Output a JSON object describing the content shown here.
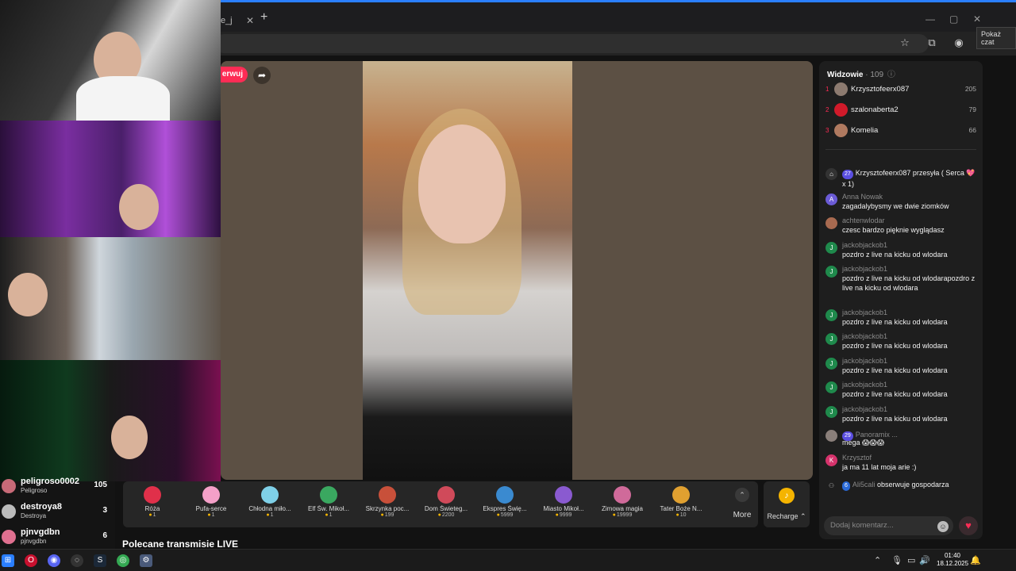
{
  "browser": {
    "tab_title": "we_j",
    "tab_close": "✕",
    "new_tab": "+",
    "tooltip": "Pokaż czat"
  },
  "stream": {
    "follow_label": "erwuj"
  },
  "viewers": {
    "title": "Widzowie",
    "count": "· 109",
    "top": [
      {
        "rank": "1",
        "name": "Krzysztofeerx087",
        "score": "205",
        "color": "#8d7b70"
      },
      {
        "rank": "2",
        "name": "szalonaberta2",
        "score": "79",
        "color": "#d11a2a"
      },
      {
        "rank": "3",
        "name": "Komelia",
        "score": "66",
        "color": "#b07a60"
      }
    ]
  },
  "chat": {
    "messages": [
      {
        "type": "gift",
        "badge": "27",
        "text": "Krzysztofeerx087 przesyła ( Serca 💖 x 1)"
      },
      {
        "user": "Anna Nowak",
        "text": "zagadalybysmy we dwie ziomków",
        "avatar": "A",
        "color": "#6b5bd6"
      },
      {
        "user": "achtenwlodar",
        "text": "czesc bardzo pięknie wyglądasz",
        "avatar": "",
        "color": "#a86a50"
      },
      {
        "user": "jackobjackob1",
        "text": "pozdro z live na kicku od wlodara",
        "avatar": "J",
        "color": "#1f8a4c"
      },
      {
        "user": "jackobjackob1",
        "text": "pozdro z live na kicku od wlodarapozdro z live na kicku od wlodara",
        "avatar": "J",
        "color": "#1f8a4c"
      },
      {
        "user": "jackobjackob1",
        "text": "pozdro z live na kicku od wlodara",
        "avatar": "J",
        "color": "#1f8a4c"
      },
      {
        "user": "jackobjackob1",
        "text": "pozdro z live na kicku od wlodara",
        "avatar": "J",
        "color": "#1f8a4c"
      },
      {
        "user": "jackobjackob1",
        "text": "pozdro z live na kicku od wlodara",
        "avatar": "J",
        "color": "#1f8a4c"
      },
      {
        "user": "jackobjackob1",
        "text": "pozdro z live na kicku od wlodara",
        "avatar": "J",
        "color": "#1f8a4c"
      },
      {
        "user": "jackobjackob1",
        "text": "pozdro z live na kicku od wlodara",
        "avatar": "J",
        "color": "#1f8a4c"
      },
      {
        "type": "badge-user",
        "badge": "29",
        "user": "Panoramix ...",
        "text": "mega 😱😱😱",
        "color": "#8a7f7a"
      },
      {
        "user": "Krzysztof",
        "text": "ja ma 11 lat moja arie :)",
        "avatar": "K",
        "color": "#d6336c"
      },
      {
        "type": "join",
        "badge": "6",
        "user": "Ali5cali",
        "text": "obserwuje gospodarza"
      }
    ],
    "input_placeholder": "Dodaj komentarz..."
  },
  "gifts": [
    {
      "name": "Róża",
      "price": "1",
      "color": "#e0304a"
    },
    {
      "name": "Pufa-serce",
      "price": "1",
      "color": "#f4a0c8"
    },
    {
      "name": "Chłodna miło...",
      "price": "1",
      "color": "#7fd0e8"
    },
    {
      "name": "Elf Św. Mikoł...",
      "price": "1",
      "color": "#3aa860"
    },
    {
      "name": "Skrzynka poc...",
      "price": "199",
      "color": "#c8503a"
    },
    {
      "name": "Dom Świeteg...",
      "price": "2200",
      "color": "#d04a5a"
    },
    {
      "name": "Ekspres Świę...",
      "price": "5999",
      "color": "#3a8ad0"
    },
    {
      "name": "Miasto Mikoł...",
      "price": "9999",
      "color": "#8a5ad0"
    },
    {
      "name": "Zimowa magia",
      "price": "19999",
      "color": "#d06a9a"
    },
    {
      "name": "Tater Boże N...",
      "price": "10",
      "color": "#e0a030"
    }
  ],
  "gift_more": "More",
  "recharge": "Recharge ⌃",
  "recommended_title": "Polecane transmisje LIVE",
  "leaderboard": [
    {
      "name": "peligroso0002",
      "sub": "Peligroso",
      "score": "105"
    },
    {
      "name": "destroya8",
      "sub": "Destroya",
      "score": "3"
    },
    {
      "name": "pjnvgdbn",
      "sub": "pjnvgdbn",
      "score": "6"
    }
  ],
  "taskbar": {
    "time": "01:40",
    "date": "18.12.2025"
  }
}
